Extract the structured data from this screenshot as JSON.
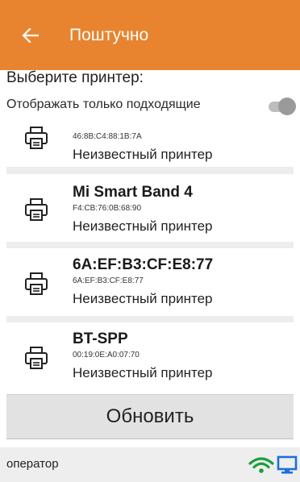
{
  "app_bar": {
    "title": "Поштучно",
    "back_icon": "arrow-left-icon"
  },
  "subheader": "Выберите принтер:",
  "filter": {
    "label": "Отображать только подходящие",
    "toggle_on": false
  },
  "printers": [
    {
      "name": "",
      "mac": "46:8B:C4:88:1B:7A",
      "type": "Неизвестный принтер"
    },
    {
      "name": "Mi Smart Band 4",
      "mac": "F4:CB:76:0B:68:90",
      "type": "Неизвестный принтер"
    },
    {
      "name": "6A:EF:B3:CF:E8:77",
      "mac": "6A:EF:B3:CF:E8:77",
      "type": "Неизвестный принтер"
    },
    {
      "name": "BT-SPP",
      "mac": "00:19:0E:A0:07:70",
      "type": "Неизвестный принтер"
    }
  ],
  "refresh_label": "Обновить",
  "status": {
    "user": "оператор",
    "wifi_color": "#1a9e3a",
    "monitor_color": "#1e6fd9"
  },
  "colors": {
    "accent": "#e8842f"
  }
}
